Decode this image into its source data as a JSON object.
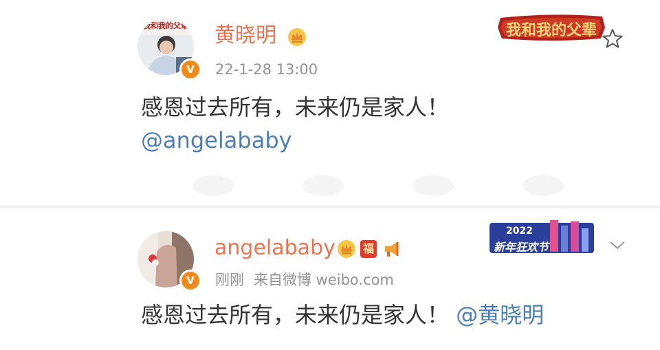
{
  "post1": {
    "author": "黄晓明",
    "timestamp": "22-1-28 13:00",
    "text": "感恩过去所有，未来仍是家人！",
    "mention": "@angelababy",
    "avatar_label": "我和我的父辈",
    "banner_label": "我和我的父辈"
  },
  "post2": {
    "author": "angelababy",
    "time": "刚刚",
    "source": "来自微博 weibo.com",
    "text": "感恩过去所有，未来仍是家人！",
    "mention": "@黄晓明",
    "badge_label": "福",
    "banner_year": "2022",
    "banner_label": "新年狂欢节"
  },
  "colors": {
    "name": "#eb7350",
    "link": "#4d7fb6",
    "verified": "#f08a1a",
    "meta": "#939393"
  },
  "icons": [
    "star-icon",
    "chevron-down-icon",
    "crown-icon",
    "verified-icon",
    "megaphone-icon"
  ]
}
